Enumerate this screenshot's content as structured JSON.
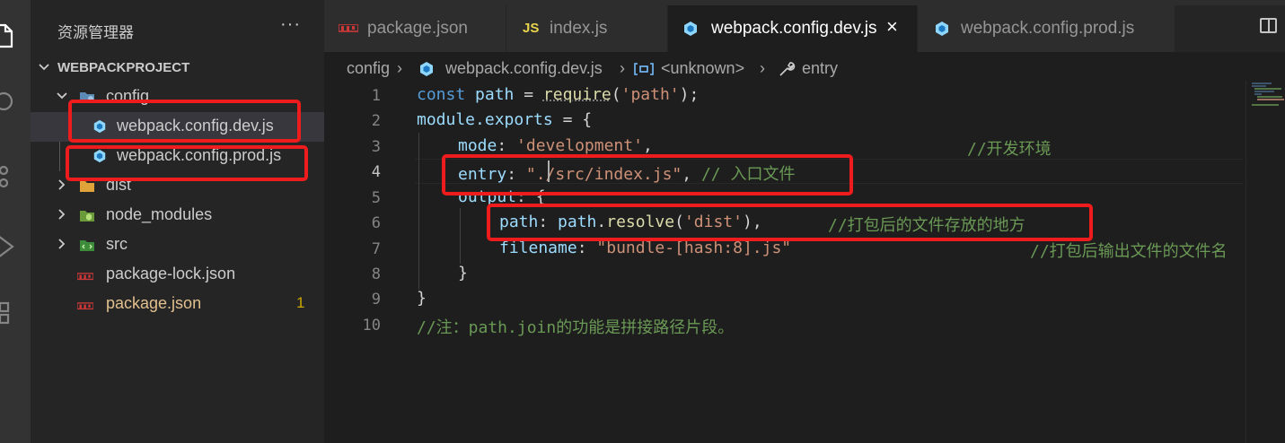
{
  "sidebar": {
    "title": "资源管理器",
    "more": "···",
    "project": "WEBPACKPROJECT",
    "items": [
      {
        "label": "config",
        "icon": "config-folder-icon"
      },
      {
        "label": "webpack.config.dev.js",
        "icon": "webpack-icon"
      },
      {
        "label": "webpack.config.prod.js",
        "icon": "webpack-icon"
      },
      {
        "label": "dist",
        "icon": "dist-folder-icon"
      },
      {
        "label": "node_modules",
        "icon": "node-folder-icon"
      },
      {
        "label": "src",
        "icon": "src-folder-icon"
      },
      {
        "label": "package-lock.json",
        "icon": "npm-icon"
      },
      {
        "label": "package.json",
        "icon": "npm-icon",
        "badge": "1"
      }
    ]
  },
  "tabs": [
    {
      "label": "package.json",
      "icon": "npm-icon"
    },
    {
      "label": "index.js",
      "icon": "js-icon",
      "badge": "JS"
    },
    {
      "label": "webpack.config.dev.js",
      "icon": "webpack-icon",
      "close": "×",
      "active": true
    },
    {
      "label": "webpack.config.prod.js",
      "icon": "webpack-icon"
    }
  ],
  "breadcrumb": {
    "folder": "config",
    "sep": "›",
    "file": "webpack.config.dev.js",
    "symbol": "<unknown>",
    "prop": "entry"
  },
  "editor": {
    "line_numbers": [
      "1",
      "2",
      "3",
      "4",
      "5",
      "6",
      "7",
      "8",
      "9",
      "10"
    ],
    "current_line": "4",
    "code": {
      "l1_const": "const",
      "l1_path": "path",
      "l1_eq": " = ",
      "l1_require": "require",
      "l1_arg": "'path'",
      "l1_end": ");",
      "l2_module": "module",
      "l2_exports": ".exports",
      "l2_rest": " = {",
      "l3_key": "mode",
      "l3_val": "'development'",
      "l3_comment": "//开发环境",
      "l4_key": "entry",
      "l4_val": "\"./src/index.js\"",
      "l4_comment": "// 入口文件",
      "l5_key": "output",
      "l5_rest": ": {",
      "l6_key": "path",
      "l6_obj": "path",
      "l6_fn": "resolve",
      "l6_arg": "'dist'",
      "l6_comment": "//打包后的文件存放的地方",
      "l7_key": "filename",
      "l7_val": "\"bundle-[hash:8].js\"",
      "l7_comment": "//打包后输出文件的文件名",
      "l8": "}",
      "l9": "}",
      "l10_comment": "//注：path.join的功能是拼接路径片段。"
    }
  },
  "colors": {
    "annotation": "#ee1c1c",
    "keyword": "#569cd6",
    "string": "#ce9178",
    "comment": "#6a9955"
  }
}
